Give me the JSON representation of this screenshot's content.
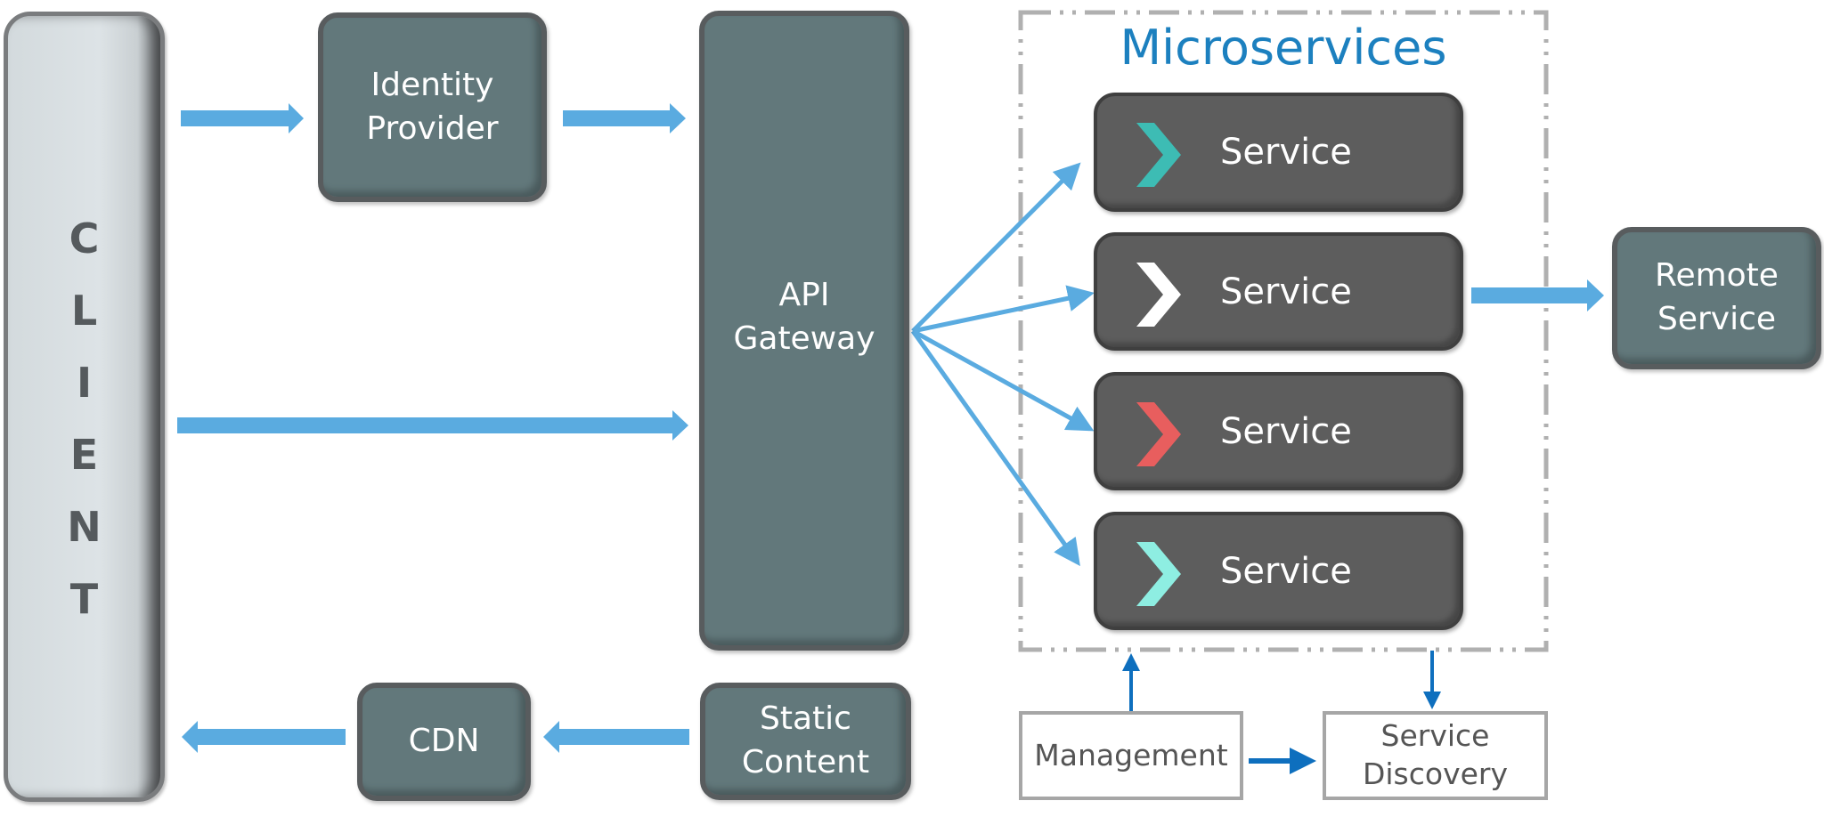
{
  "diagram": {
    "title": "Microservices",
    "client": {
      "letters": [
        "C",
        "L",
        "I",
        "E",
        "N",
        "T"
      ]
    },
    "identity_provider": {
      "lines": [
        "Identity",
        "Provider"
      ]
    },
    "api_gateway": {
      "lines": [
        "API",
        "Gateway"
      ]
    },
    "static_content": {
      "lines": [
        "Static",
        "Content"
      ]
    },
    "cdn": {
      "lines": [
        "CDN"
      ]
    },
    "remote_service": {
      "lines": [
        "Remote",
        "Service"
      ]
    },
    "services": [
      {
        "label": "Service",
        "chevron_color": "#3dbcb4"
      },
      {
        "label": "Service",
        "chevron_color": "#ffffff"
      },
      {
        "label": "Service",
        "chevron_color": "#e85e5e"
      },
      {
        "label": "Service",
        "chevron_color": "#8eeee2"
      }
    ],
    "management": {
      "lines": [
        "Management"
      ]
    },
    "service_discovery": {
      "lines": [
        "Service",
        "Discovery"
      ]
    },
    "colors": {
      "arrow_light": "#5aabe0",
      "arrow_dark": "#0e6fbe",
      "title": "#1c80bf",
      "teal_box": "#62787b",
      "service_box": "#5d5d5d",
      "dashed_border": "#b0b0b0"
    },
    "connections": [
      {
        "from": "client",
        "to": "identity_provider"
      },
      {
        "from": "identity_provider",
        "to": "api_gateway"
      },
      {
        "from": "client",
        "to": "api_gateway"
      },
      {
        "from": "api_gateway",
        "to": "services.0"
      },
      {
        "from": "api_gateway",
        "to": "services.1"
      },
      {
        "from": "api_gateway",
        "to": "services.2"
      },
      {
        "from": "api_gateway",
        "to": "services.3"
      },
      {
        "from": "services.1",
        "to": "remote_service"
      },
      {
        "from": "static_content",
        "to": "cdn"
      },
      {
        "from": "cdn",
        "to": "client"
      },
      {
        "from": "management",
        "to": "microservices"
      },
      {
        "from": "microservices",
        "to": "service_discovery"
      },
      {
        "from": "management",
        "to": "service_discovery"
      }
    ]
  }
}
